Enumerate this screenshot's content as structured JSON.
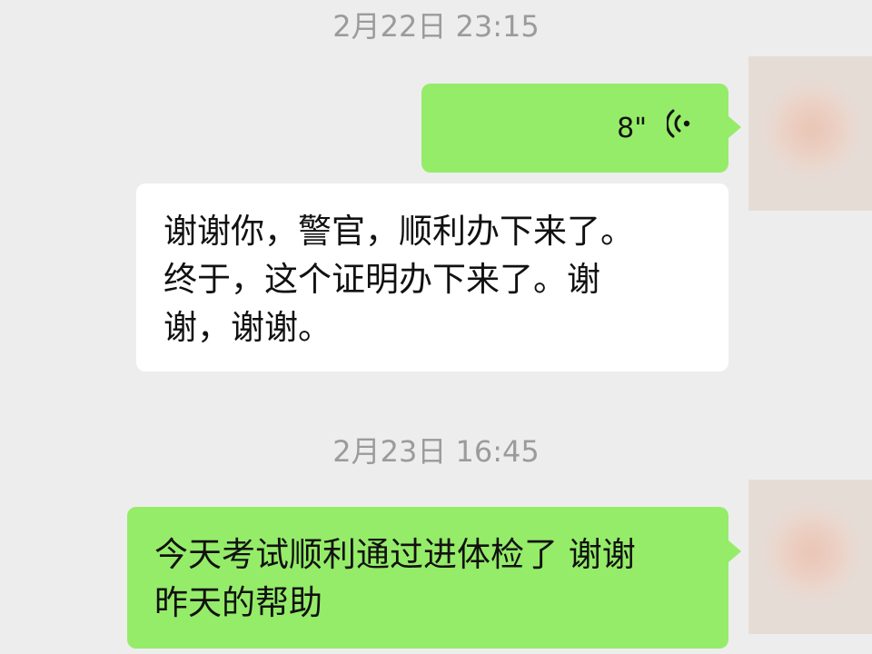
{
  "chat": {
    "timestamp_1": "2月22日 23:15",
    "timestamp_2": "2月23日 16:45",
    "messages": [
      {
        "side": "right",
        "type": "voice",
        "duration": "8\""
      },
      {
        "side": "left",
        "type": "text",
        "text": "谢谢你，警官，顺利办下来了。\n终于，这个证明办下来了。谢\n谢，谢谢。"
      },
      {
        "side": "right",
        "type": "text",
        "text": "今天考试顺利通过进体检了 谢谢\n昨天的帮助"
      }
    ],
    "icons": {
      "voice": "voice-wave-icon",
      "avatar": "avatar-blurred"
    },
    "colors": {
      "background": "#ededed",
      "sent_bubble": "#95ec69",
      "received_bubble": "#ffffff",
      "timestamp": "#9b9b9b"
    }
  }
}
